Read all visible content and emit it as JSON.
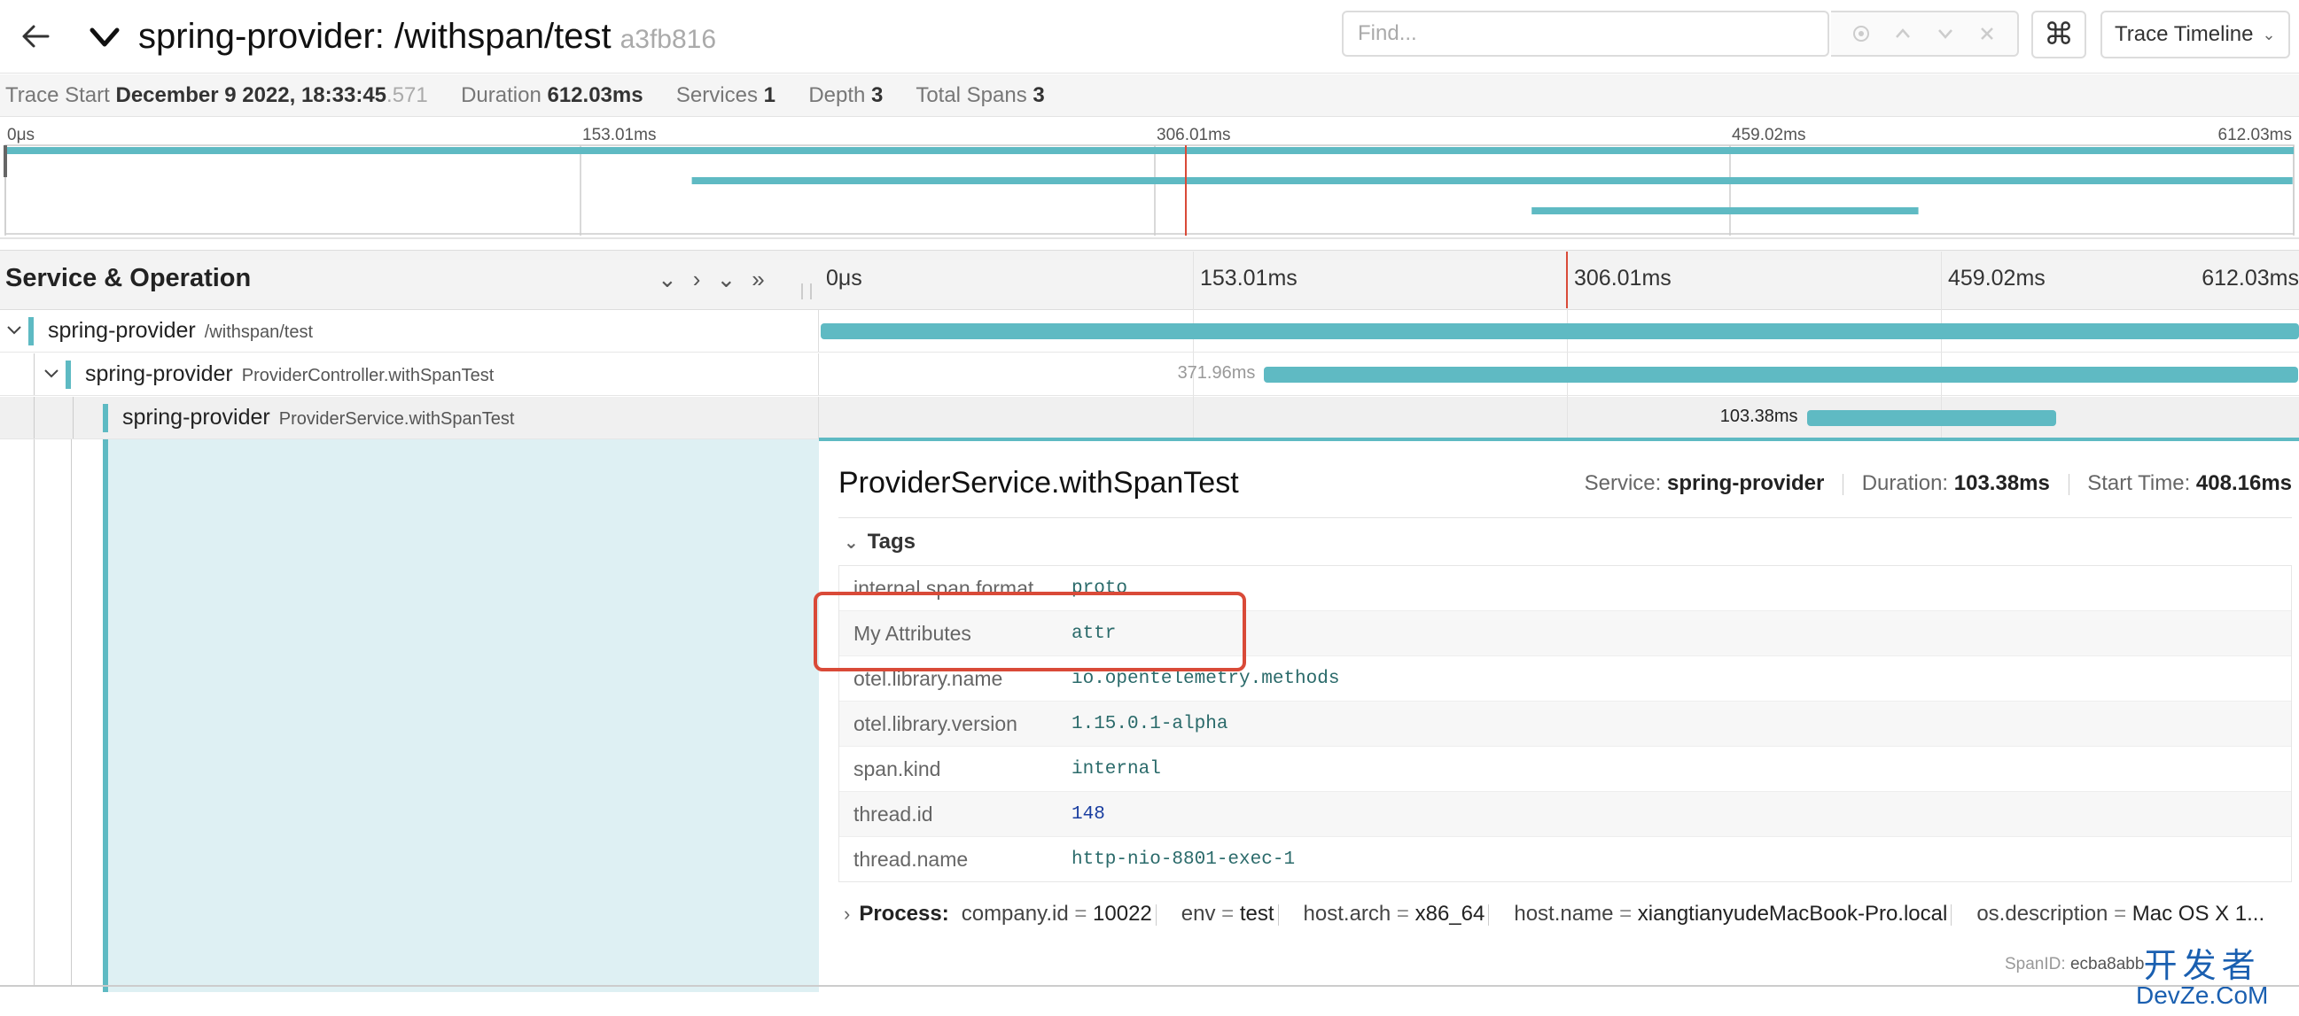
{
  "header": {
    "title": "spring-provider: /withspan/test",
    "trace_id": "a3fb816",
    "find_placeholder": "Find...",
    "kbd_icon": "⌘",
    "view_select": "Trace Timeline"
  },
  "summary": {
    "trace_start_label": "Trace Start",
    "trace_start_value": "December 9 2022, 18:33:45",
    "trace_start_ms": ".571",
    "duration_label": "Duration",
    "duration_value": "612.03ms",
    "services_label": "Services",
    "services_value": "1",
    "depth_label": "Depth",
    "depth_value": "3",
    "total_spans_label": "Total Spans",
    "total_spans_value": "3"
  },
  "ticks": [
    "0μs",
    "153.01ms",
    "306.01ms",
    "459.02ms",
    "612.03ms"
  ],
  "columns": {
    "service_operation": "Service & Operation"
  },
  "spans": [
    {
      "service": "spring-provider",
      "operation": "/withspan/test",
      "start_frac": 0.0,
      "end_frac": 1.0,
      "label": ""
    },
    {
      "service": "spring-provider",
      "operation": "ProviderController.withSpanTest",
      "start_frac": 0.3,
      "end_frac": 0.9995,
      "label": "371.96ms"
    },
    {
      "service": "spring-provider",
      "operation": "ProviderService.withSpanTest",
      "start_frac": 0.667,
      "end_frac": 0.836,
      "label": "103.38ms"
    }
  ],
  "cursor_frac": 0.5046,
  "detail": {
    "operation": "ProviderService.withSpanTest",
    "service_label": "Service:",
    "service_value": "spring-provider",
    "duration_label": "Duration:",
    "duration_value": "103.38ms",
    "start_label": "Start Time:",
    "start_value": "408.16ms",
    "tags_label": "Tags",
    "tags": [
      {
        "key": "internal.span.format",
        "value": "proto"
      },
      {
        "key": "My Attributes",
        "value": "attr"
      },
      {
        "key": "otel.library.name",
        "value": "io.opentelemetry.methods"
      },
      {
        "key": "otel.library.version",
        "value": "1.15.0.1-alpha"
      },
      {
        "key": "span.kind",
        "value": "internal"
      },
      {
        "key": "thread.id",
        "value": "148"
      },
      {
        "key": "thread.name",
        "value": "http-nio-8801-exec-1"
      }
    ],
    "process_label": "Process:",
    "process": [
      {
        "key": "company.id",
        "value": "10022"
      },
      {
        "key": "env",
        "value": "test"
      },
      {
        "key": "host.arch",
        "value": "x86_64"
      },
      {
        "key": "host.name",
        "value": "xiangtianyudeMacBook-Pro.local"
      },
      {
        "key": "os.description",
        "value": "Mac OS X 1..."
      }
    ],
    "spanid_label": "SpanID:",
    "spanid_value": "ecba8abb"
  },
  "watermark": {
    "top": "开发者",
    "bottom": "DevZe.CoM"
  },
  "colors": {
    "span": "#5fbac3",
    "cursor": "#d94a38",
    "highlight": "#d94a38"
  }
}
